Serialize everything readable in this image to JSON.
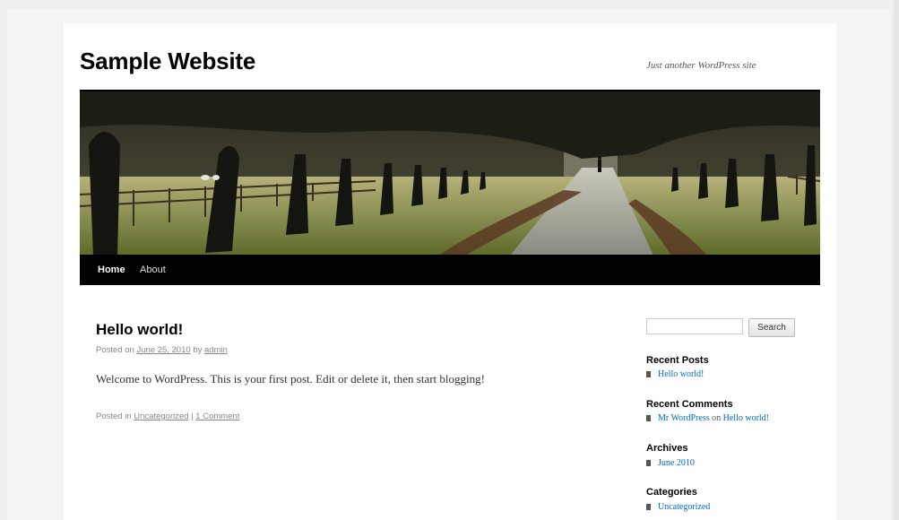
{
  "site": {
    "title": "Sample Website",
    "description": "Just another WordPress site"
  },
  "nav": {
    "items": [
      {
        "label": "Home",
        "current": true
      },
      {
        "label": "About",
        "current": false
      }
    ]
  },
  "post": {
    "title": "Hello world!",
    "meta": {
      "posted_on": "Posted on",
      "date": "June 25, 2010",
      "by": "by",
      "author": "admin"
    },
    "content": "Welcome to WordPress. This is your first post. Edit or delete it, then start blogging!",
    "footer": {
      "posted_in": "Posted in",
      "category": "Uncategorized",
      "separator": "|",
      "comments": "1 Comment"
    }
  },
  "sidebar": {
    "search_button": "Search",
    "search_value": "",
    "recent_posts": {
      "title": "Recent Posts",
      "items": [
        "Hello world!"
      ]
    },
    "recent_comments": {
      "title": "Recent Comments",
      "author": "Mr WordPress",
      "on": "on",
      "post": "Hello world!"
    },
    "archives": {
      "title": "Archives",
      "items": [
        "June 2010"
      ]
    },
    "categories": {
      "title": "Categories",
      "items": [
        "Uncategorized"
      ]
    }
  },
  "colors": {
    "link": "#0066cc",
    "nav_bg": "#000000",
    "page_bg": "#ffffff"
  }
}
